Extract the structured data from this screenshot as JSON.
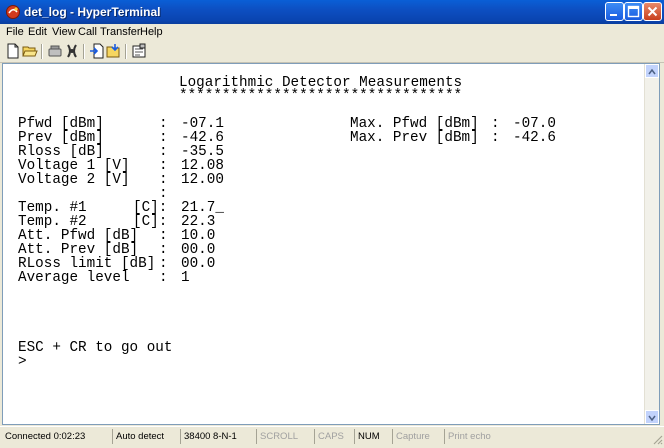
{
  "window": {
    "title": "det_log - HyperTerminal"
  },
  "menu": [
    "File",
    "Edit",
    "View",
    "Call",
    "Transfer",
    "Help"
  ],
  "toolbar_icons": [
    "new-icon",
    "open-icon",
    "call-icon",
    "hangup-icon",
    "send-icon",
    "receive-icon",
    "properties-icon"
  ],
  "terminal": {
    "header_title": "Logarithmic Detector Measurements",
    "header_rule": "*********************************",
    "left": [
      {
        "label": "Pfwd [dBm]",
        "sep": ":",
        "value": "-07.1"
      },
      {
        "label": "Prev [dBm]",
        "sep": ":",
        "value": "-42.6"
      },
      {
        "label": "Rloss [dB]",
        "sep": ":",
        "value": "-35.5"
      },
      {
        "label": "Voltage 1 [V]",
        "sep": ":",
        "value": "12.08"
      },
      {
        "label": "Voltage 2 [V]",
        "sep": ":",
        "value": "12.00"
      }
    ],
    "blank_sep": ":",
    "temps": [
      {
        "label": "Temp. #1",
        "unit": "[C]:",
        "value": "21.7_"
      },
      {
        "label": "Temp. #2",
        "unit": "[C]:",
        "value": "22.3"
      }
    ],
    "lower": [
      {
        "label": "Att. Pfwd [dB]",
        "sep": ":",
        "value": "10.0"
      },
      {
        "label": "Att. Prev [dB]",
        "sep": ":",
        "value": "00.0"
      },
      {
        "label": "RLoss limit [dB]",
        "sep": ":",
        "value": "00.0"
      },
      {
        "label": "Average level",
        "sep": ":",
        "value": "1"
      }
    ],
    "right": [
      {
        "label": "Max. Pfwd [dBm]",
        "sep": ":",
        "value": "-07.0"
      },
      {
        "label": "Max. Prev [dBm]",
        "sep": ":",
        "value": "-42.6"
      }
    ],
    "exit_hint": "ESC + CR to go out",
    "prompt": ">"
  },
  "status": {
    "connected": "Connected 0:02:23",
    "detect": "Auto detect",
    "port": "38400 8-N-1",
    "scroll": "SCROLL",
    "caps": "CAPS",
    "num": "NUM",
    "capture": "Capture",
    "print_echo": "Print echo"
  },
  "colors": {
    "title_bar": "#0a4fc2",
    "window_face": "#ece9d8",
    "terminal_bg": "#ffffff",
    "terminal_text": "#000000"
  }
}
